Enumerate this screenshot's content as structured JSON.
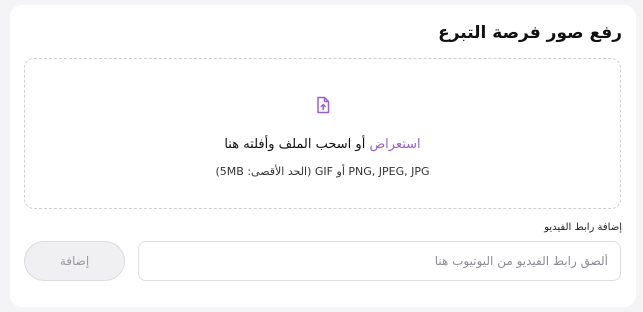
{
  "card": {
    "title": "رفع صور فرصة التبرع"
  },
  "dropzone": {
    "icon": "file-upload-icon",
    "browse_label": "استعراض",
    "drag_text": " أو اسحب الملف وأفلته هنا",
    "formats_text": "PNG, JPEG, JPG أو GIF (الحد الأقصى: 5MB)"
  },
  "video": {
    "label": "إضافة رابط الفيديو",
    "placeholder": "ألصق رابط الفيديو من اليوتيوب هنا",
    "value": "",
    "add_button_label": "إضافة"
  },
  "colors": {
    "accent": "#9b5fd0",
    "border": "#dedee3",
    "disabled_bg": "#f0f0f2",
    "disabled_text": "#9a9aa0"
  }
}
